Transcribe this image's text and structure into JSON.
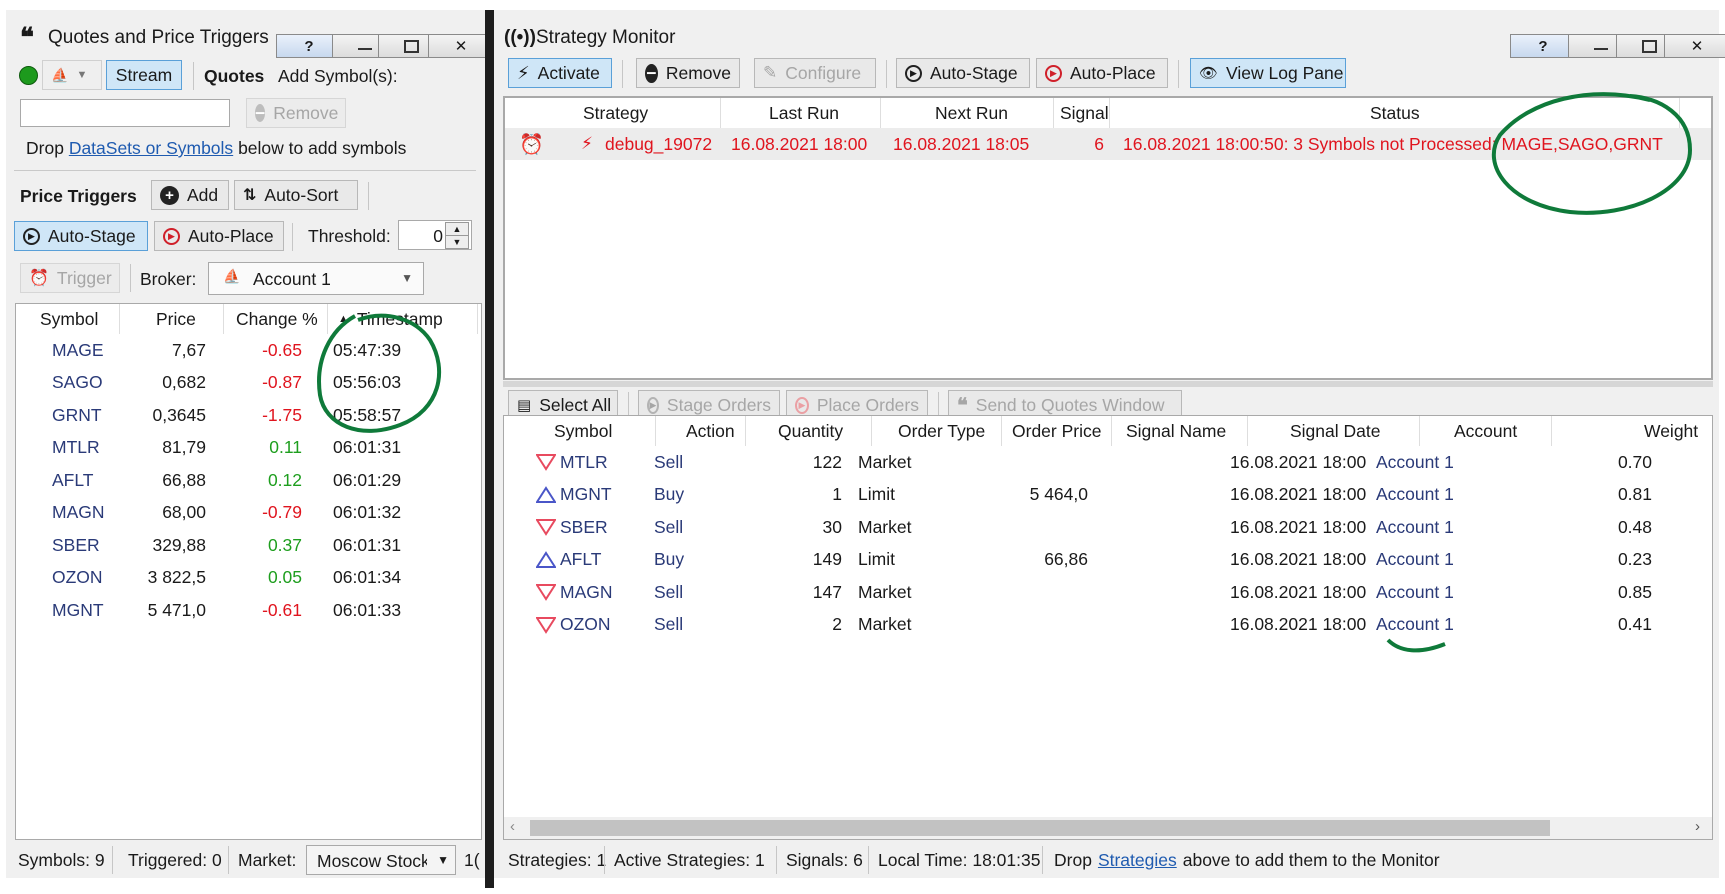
{
  "left": {
    "title": "Quotes and Price Triggers",
    "stream_label": "Stream",
    "quotes_label": "Quotes",
    "add_symbols_label": "Add Symbol(s):",
    "symbol_input_value": "",
    "remove_label": "Remove",
    "drop_prefix": "Drop",
    "drop_link": "DataSets or Symbols",
    "drop_suffix": "below to add symbols",
    "price_triggers_label": "Price Triggers",
    "add_label": "Add",
    "auto_sort_label": "Auto-Sort",
    "auto_stage_label": "Auto-Stage",
    "auto_place_label": "Auto-Place",
    "threshold_label": "Threshold:",
    "threshold_value": "0",
    "trigger_label": "Trigger",
    "broker_label": "Broker:",
    "broker_value": "Account 1",
    "columns": [
      "Symbol",
      "Price",
      "Change %",
      "Timestamp"
    ],
    "rows": [
      {
        "symbol": "MAGE",
        "price": "7,67",
        "change": "-0.65",
        "time": "05:47:39",
        "positive": false
      },
      {
        "symbol": "SAGO",
        "price": "0,682",
        "change": "-0.87",
        "time": "05:56:03",
        "positive": false
      },
      {
        "symbol": "GRNT",
        "price": "0,3645",
        "change": "-1.75",
        "time": "05:58:57",
        "positive": false
      },
      {
        "symbol": "MTLR",
        "price": "81,79",
        "change": "0.11",
        "time": "06:01:31",
        "positive": true
      },
      {
        "symbol": "AFLT",
        "price": "66,88",
        "change": "0.12",
        "time": "06:01:29",
        "positive": true
      },
      {
        "symbol": "MAGN",
        "price": "68,00",
        "change": "-0.79",
        "time": "06:01:32",
        "positive": false
      },
      {
        "symbol": "SBER",
        "price": "329,88",
        "change": "0.37",
        "time": "06:01:31",
        "positive": true
      },
      {
        "symbol": "OZON",
        "price": "3 822,5",
        "change": "0.05",
        "time": "06:01:34",
        "positive": true
      },
      {
        "symbol": "MGNT",
        "price": "5 471,0",
        "change": "-0.61",
        "time": "06:01:33",
        "positive": false
      }
    ],
    "status": {
      "symbols": "Symbols: 9",
      "triggered": "Triggered: 0",
      "market_label": "Market:",
      "market_value": "Moscow Stock",
      "extra": "1("
    }
  },
  "right": {
    "title": "Strategy Monitor",
    "toolbar": {
      "activate": "Activate",
      "remove": "Remove",
      "configure": "Configure",
      "auto_stage": "Auto-Stage",
      "auto_place": "Auto-Place",
      "view_log": "View Log Pane"
    },
    "strategy_columns": [
      "Strategy",
      "Last Run",
      "Next Run",
      "Signals",
      "Status"
    ],
    "strategy_rows": [
      {
        "name": "debug_19072",
        "last_run": "16.08.2021 18:00",
        "next_run": "16.08.2021 18:05",
        "signals": "6",
        "status": "16.08.2021 18:00:50: 3 Symbols not Processed: MAGE,SAGO,GRNT"
      }
    ],
    "orders_toolbar": {
      "select_all": "Select All",
      "stage_orders": "Stage Orders",
      "place_orders": "Place Orders",
      "send_to_quotes": "Send to Quotes Window"
    },
    "order_columns": [
      "Symbol",
      "Action",
      "Quantity",
      "Order Type",
      "Order Price",
      "Signal Name",
      "Signal Date",
      "Account",
      "Weight"
    ],
    "order_rows": [
      {
        "symbol": "MTLR",
        "action": "Sell",
        "quantity": "122",
        "order_type": "Market",
        "order_price": "",
        "signal_name": "",
        "signal_date": "16.08.2021 18:00",
        "account": "Account 1",
        "weight": "0.70"
      },
      {
        "symbol": "MGNT",
        "action": "Buy",
        "quantity": "1",
        "order_type": "Limit",
        "order_price": "5 464,0",
        "signal_name": "",
        "signal_date": "16.08.2021 18:00",
        "account": "Account 1",
        "weight": "0.81"
      },
      {
        "symbol": "SBER",
        "action": "Sell",
        "quantity": "30",
        "order_type": "Market",
        "order_price": "",
        "signal_name": "",
        "signal_date": "16.08.2021 18:00",
        "account": "Account 1",
        "weight": "0.48"
      },
      {
        "symbol": "AFLT",
        "action": "Buy",
        "quantity": "149",
        "order_type": "Limit",
        "order_price": "66,86",
        "signal_name": "",
        "signal_date": "16.08.2021 18:00",
        "account": "Account 1",
        "weight": "0.23"
      },
      {
        "symbol": "MAGN",
        "action": "Sell",
        "quantity": "147",
        "order_type": "Market",
        "order_price": "",
        "signal_name": "",
        "signal_date": "16.08.2021 18:00",
        "account": "Account 1",
        "weight": "0.85"
      },
      {
        "symbol": "OZON",
        "action": "Sell",
        "quantity": "2",
        "order_type": "Market",
        "order_price": "",
        "signal_name": "",
        "signal_date": "16.08.2021 18:00",
        "account": "Account 1",
        "weight": "0.41"
      }
    ],
    "status": {
      "strategies": "Strategies: 1",
      "active": "Active Strategies: 1",
      "signals": "Signals: 6",
      "local_time": "Local Time: 18:01:35",
      "drop_prefix": "Drop",
      "drop_link": "Strategies",
      "drop_suffix": "above to add them to the Monitor"
    }
  },
  "colors": {
    "negative": "#e0141e",
    "positive": "#1e9e1e",
    "sell_triangle": "#e84a5f",
    "buy_triangle": "#4a56c8",
    "annotation": "#0f7a3a",
    "link": "#1f5bb0"
  }
}
